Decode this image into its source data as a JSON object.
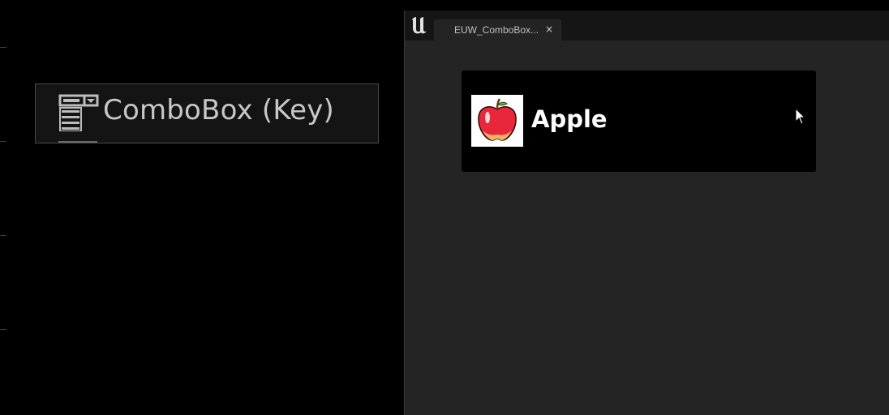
{
  "palette": {
    "item_label": "ComboBox (Key)",
    "icon": "combobox-icon"
  },
  "editor": {
    "logo": "unreal-engine-logo",
    "tab": {
      "label": "EUW_ComboBox...",
      "close_glyph": "×"
    },
    "combo_box": {
      "selected_value": "Apple",
      "thumbnail_icon": "apple-icon"
    }
  },
  "colors": {
    "background": "#000000",
    "editor_background": "#242424",
    "titlebar": "#151515",
    "apple_red": "#e8283a",
    "palette_text": "#c8c8c8"
  }
}
